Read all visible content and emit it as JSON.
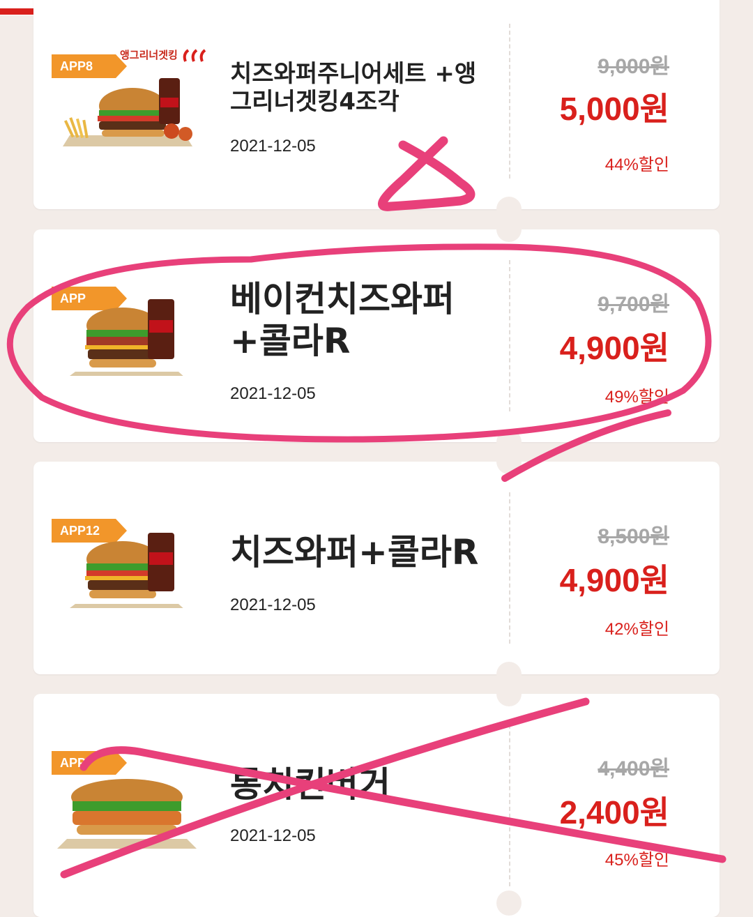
{
  "coupons": [
    {
      "badge": "APP8",
      "promo_tag": "앵그리너겟킹",
      "name": "치즈와퍼주니어세트 +앵그리너겟킹4조각",
      "date": "2021-12-05",
      "original_price": "9,000원",
      "sale_price": "5,000원",
      "discount": "44%할인"
    },
    {
      "badge": "APP",
      "name": "베이컨치즈와퍼 +콜라R",
      "date": "2021-12-05",
      "original_price": "9,700원",
      "sale_price": "4,900원",
      "discount": "49%할인"
    },
    {
      "badge": "APP12",
      "name": "치즈와퍼+콜라R",
      "date": "2021-12-05",
      "original_price": "8,500원",
      "sale_price": "4,900원",
      "discount": "42%할인"
    },
    {
      "badge": "APP",
      "name": "통치킨버거",
      "date": "2021-12-05",
      "original_price": "4,400원",
      "sale_price": "2,400원",
      "discount": "45%할인"
    }
  ],
  "colors": {
    "brand_red": "#d9201c",
    "badge_orange": "#f2962a",
    "annotation_pink": "#e8407a"
  },
  "icons": [
    "burger-icon",
    "cola-cup-icon",
    "fries-icon",
    "chili-icon"
  ]
}
